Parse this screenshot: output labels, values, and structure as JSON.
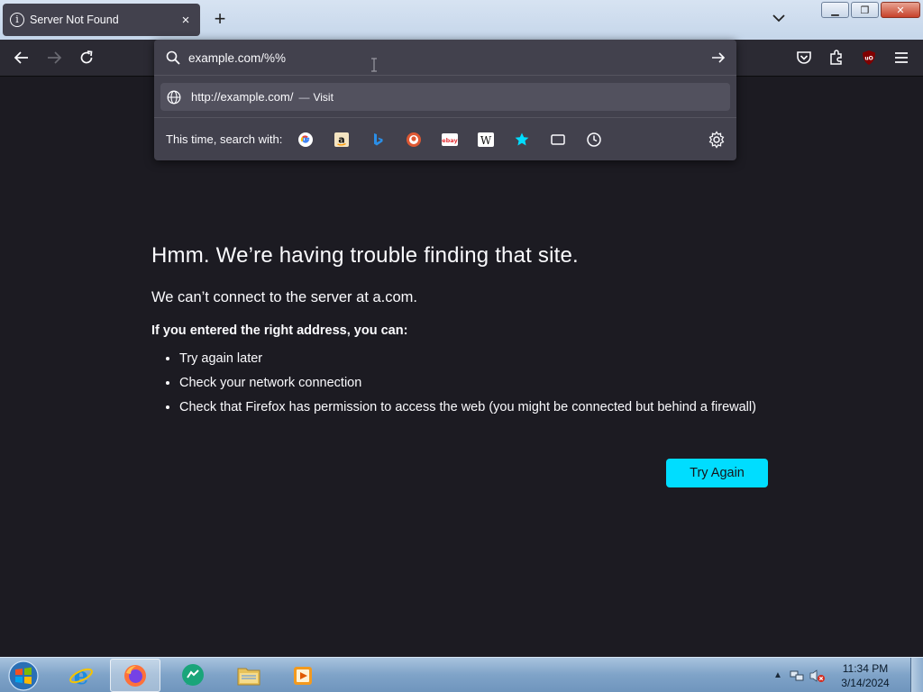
{
  "tab": {
    "title": "Server Not Found",
    "close_label": "×"
  },
  "toolbar": {
    "new_tab_label": "+"
  },
  "window_controls": {
    "minimize": "▁",
    "restore": "❐",
    "close": "✕"
  },
  "urlbar": {
    "value": "example.com/%%",
    "suggestion": {
      "url": "http://example.com/",
      "separator": "—",
      "action": "Visit"
    },
    "search_with_label": "This time, search with:",
    "engines": [
      "google-icon",
      "amazon-icon",
      "bing-icon",
      "duckduckgo-icon",
      "ebay-icon",
      "wikipedia-icon",
      "bookmarks-icon",
      "tabs-icon",
      "history-icon"
    ]
  },
  "error": {
    "title": "Hmm. We’re having trouble finding that site.",
    "description": "We can’t connect to the server at a.com.",
    "subheading": "If you entered the right address, you can:",
    "items": [
      "Try again later",
      "Check your network connection",
      "Check that Firefox has permission to access the web (you might be connected but behind a firewall)"
    ],
    "button_label": "Try Again"
  },
  "taskbar": {
    "time": "11:34 PM",
    "date": "3/14/2024",
    "tray_arrow": "▲"
  },
  "colors": {
    "accent": "#00ddff",
    "page_bg": "#1c1b22",
    "panel_bg": "#42414d",
    "toolbar_bg": "#2b2a33"
  }
}
